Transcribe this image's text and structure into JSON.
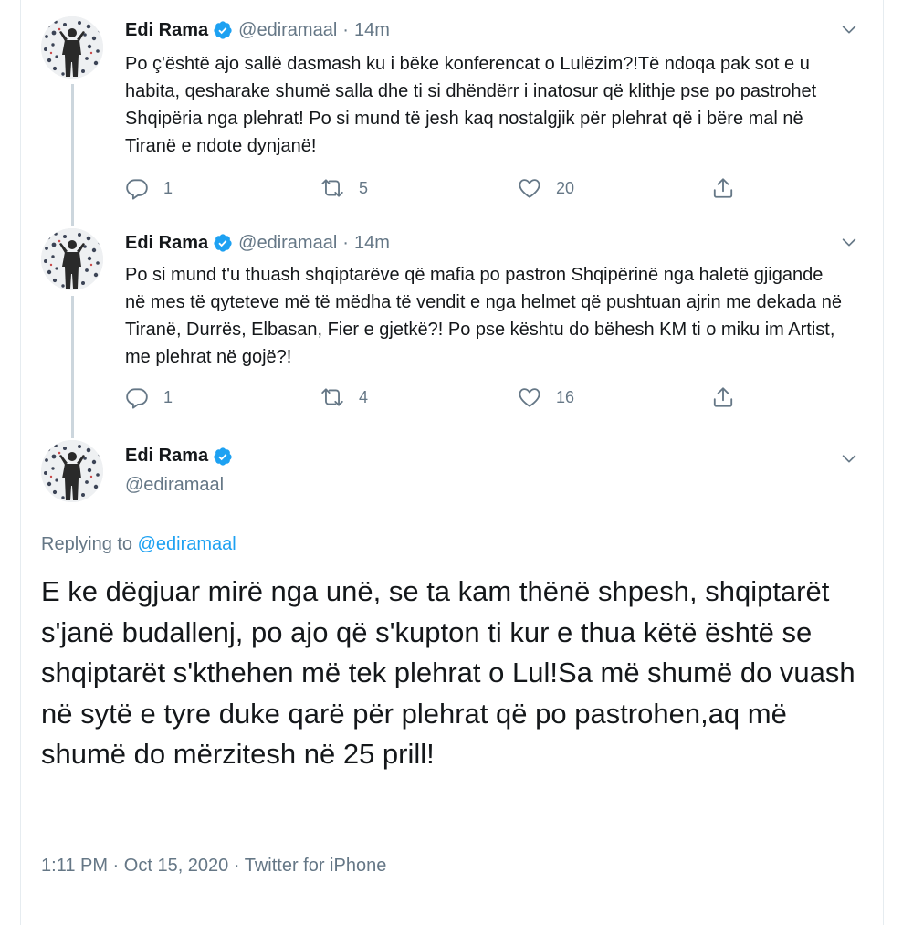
{
  "colors": {
    "verified": "#1da1f2",
    "link": "#1da1f2",
    "muted": "#657786",
    "thread_line": "#ccd6dd"
  },
  "tweets": [
    {
      "name": "Edi Rama",
      "handle": "@ediramaal",
      "separator": "·",
      "time": "14m",
      "text": "Po ç'është ajo sallë dasmash ku i bëke konferencat o Lulëzim?!Të ndoqa pak sot e u habita, qesharake shumë salla dhe ti si dhëndërr i inatosur që klithje pse po pastrohet Shqipëria nga plehrat! Po si mund të jesh kaq nostalgjik për plehrat që i bëre mal në Tiranë e ndote dynjanë!",
      "replies": "1",
      "retweets": "5",
      "likes": "20"
    },
    {
      "name": "Edi Rama",
      "handle": "@ediramaal",
      "separator": "·",
      "time": "14m",
      "text": "Po si mund t'u thuash shqiptarëve që mafia po pastron Shqipërinë nga haletë gjigande në mes të qyteteve më të mëdha të vendit e nga helmet që pushtuan ajrin me dekada në Tiranë, Durrës, Elbasan, Fier e gjetkë?! Po pse kështu do bëhesh KM ti o miku im Artist, me plehrat në gojë?!",
      "replies": "1",
      "retweets": "4",
      "likes": "16"
    }
  ],
  "main": {
    "name": "Edi Rama",
    "handle": "@ediramaal",
    "replying_prefix": "Replying to",
    "replying_to": "@ediramaal",
    "text": "E ke dëgjuar mirë nga unë, se ta kam thënë shpesh, shqiptarët s'janë budallenj, po ajo që s'kupton ti kur e thua këtë është se shqiptarët s'kthehen më tek plehrat o Lul!Sa më shumë do vuash në sytë e tyre duke qarë për plehrat që po pastrohen,aq më shumë do mërzitesh në 25 prill!",
    "timestamp": "1:11 PM · Oct 15, 2020 · Twitter for iPhone"
  },
  "icons": [
    "verified-badge-icon",
    "chevron-down-icon",
    "reply-icon",
    "retweet-icon",
    "like-icon",
    "share-icon"
  ]
}
